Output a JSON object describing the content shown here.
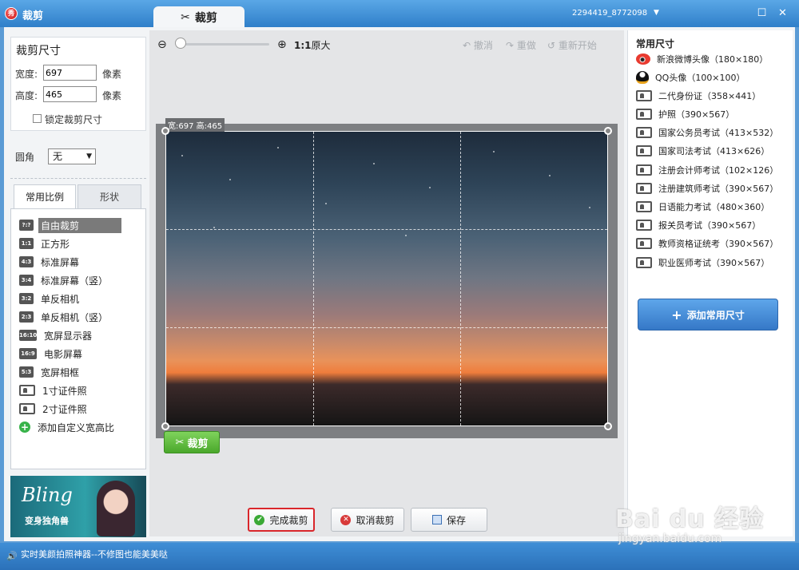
{
  "window": {
    "app_title": "裁剪",
    "app_logo_text": "秀",
    "active_tab": "裁剪",
    "user_id": "2294419_8772098",
    "max_symbol": "☐",
    "close_symbol": "✕"
  },
  "size_panel": {
    "title": "裁剪尺寸",
    "width_label": "宽度:",
    "width_value": "697",
    "width_unit": "像素",
    "height_label": "高度:",
    "height_value": "465",
    "height_unit": "像素",
    "lock_label": "锁定裁剪尺寸",
    "lock_checked": false,
    "corner_label": "圆角",
    "corner_value": "无"
  },
  "ratio_tabs": [
    {
      "label": "常用比例",
      "active": true
    },
    {
      "label": "形状",
      "active": false
    }
  ],
  "ratios": [
    {
      "badge": "?:?",
      "label": "自由裁剪",
      "selected": true
    },
    {
      "badge": "1:1",
      "label": "正方形"
    },
    {
      "badge": "4:3",
      "label": "标准屏幕"
    },
    {
      "badge": "3:4",
      "label": "标准屏幕（竖）"
    },
    {
      "badge": "3:2",
      "label": "单反相机"
    },
    {
      "badge": "2:3",
      "label": "单反相机（竖）"
    },
    {
      "badge": "16:10",
      "label": "宽屏显示器"
    },
    {
      "badge": "16:9",
      "label": "电影屏幕"
    },
    {
      "badge": "5:3",
      "label": "宽屏相框"
    },
    {
      "badge": "",
      "icon": "id-card-icon",
      "label": "1寸证件照"
    },
    {
      "badge": "",
      "icon": "id-card-icon",
      "label": "2寸证件照"
    },
    {
      "badge": "",
      "icon": "add-icon",
      "label": "添加自定义宽高比"
    }
  ],
  "banner": {
    "title": "Bling",
    "subtitle": "变身独角兽"
  },
  "toolbar": {
    "zoom_out_icon": "zoom-out-icon",
    "zoom_in_icon": "zoom-in-icon",
    "zoom_level": 0.1,
    "orig_ratio": "1:1",
    "orig_label": "原大",
    "undo_label": "撤消",
    "redo_label": "重做",
    "restart_label": "重新开始"
  },
  "canvas": {
    "dims_label": "宽:697 高:465",
    "crop_button": "裁剪"
  },
  "actions": {
    "done_label": "完成裁剪",
    "cancel_label": "取消裁剪",
    "save_label": "保存"
  },
  "common_sizes": {
    "title": "常用尺寸",
    "items": [
      {
        "icon": "weibo-icon",
        "label": "新浪微博头像（180×180）"
      },
      {
        "icon": "qq-icon",
        "label": "QQ头像（100×100）"
      },
      {
        "icon": "id-card-icon",
        "label": "二代身份证（358×441）"
      },
      {
        "icon": "id-card-icon",
        "label": "护照（390×567）"
      },
      {
        "icon": "id-card-icon",
        "label": "国家公务员考试（413×532）"
      },
      {
        "icon": "id-card-icon",
        "label": "国家司法考试（413×626）"
      },
      {
        "icon": "id-card-icon",
        "label": "注册会计师考试（102×126）"
      },
      {
        "icon": "id-card-icon",
        "label": "注册建筑师考试（390×567）"
      },
      {
        "icon": "id-card-icon",
        "label": "日语能力考试（480×360）"
      },
      {
        "icon": "id-card-icon",
        "label": "报关员考试（390×567）"
      },
      {
        "icon": "id-card-icon",
        "label": "教师资格证统考（390×567）"
      },
      {
        "icon": "id-card-icon",
        "label": "职业医师考试（390×567）"
      }
    ],
    "add_button": "添加常用尺寸"
  },
  "status": {
    "text": "实时美颜拍照神器--不修图也能美美哒"
  },
  "watermark": {
    "big": "Bai du 经验",
    "small": "jingyan.baidu.com"
  },
  "colors": {
    "accent": "#3578c7",
    "titlebar": "#2f7fc9",
    "crop_green": "#4aa82b",
    "highlight_red": "#d9262b"
  }
}
